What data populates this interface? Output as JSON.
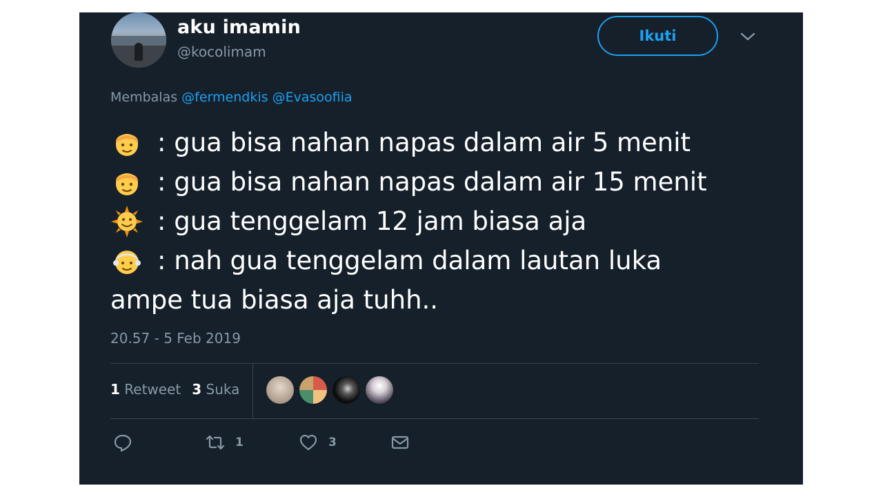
{
  "user": {
    "display_name": "aku imamin",
    "handle": "@kocolimam"
  },
  "follow_button": {
    "label": "Ikuti"
  },
  "reply_to": {
    "prefix": "Membalas",
    "mentions": [
      "@fermendkis",
      "@Evasoofiia"
    ]
  },
  "tweet": {
    "lines": [
      {
        "emoji": "boy-face",
        "text": ": gua bisa nahan napas dalam air 5 menit"
      },
      {
        "emoji": "boy-face",
        "text": ": gua bisa nahan napas dalam air 15 menit"
      },
      {
        "emoji": "sun-face",
        "text": ": gua tenggelam 12 jam biasa aja"
      },
      {
        "emoji": "old-man-face",
        "text": ": nah gua tenggelam dalam lautan luka"
      },
      {
        "emoji": "",
        "text": "ampe tua biasa aja tuhh.."
      }
    ]
  },
  "timestamp": "20.57 - 5 Feb 2019",
  "stats": {
    "retweet_count": "1",
    "retweet_label": "Retweet",
    "like_count": "3",
    "like_label": "Suka"
  },
  "actions": {
    "reply_icon": "reply-icon",
    "retweet_icon": "retweet-icon",
    "retweet_count": "1",
    "like_icon": "heart-icon",
    "like_count": "3",
    "dm_icon": "envelope-icon"
  },
  "colors": {
    "background": "#15202b",
    "accent": "#1da1f2",
    "muted": "#8899a6",
    "divider": "#38444d"
  }
}
